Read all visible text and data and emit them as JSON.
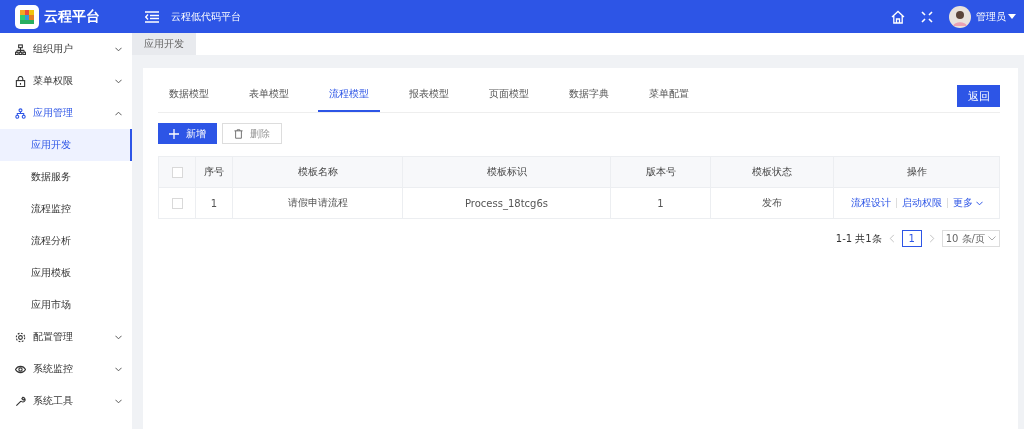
{
  "app": {
    "logo_text": "云程平台",
    "title": "云程低代码平台",
    "user": "管理员"
  },
  "sidebar": {
    "items": [
      {
        "label": "组织用户",
        "expanded": false,
        "selected": false
      },
      {
        "label": "菜单权限",
        "expanded": false,
        "selected": false
      },
      {
        "label": "应用管理",
        "expanded": true,
        "selected": true,
        "children": [
          {
            "label": "应用开发",
            "selected": true
          },
          {
            "label": "数据服务",
            "selected": false
          },
          {
            "label": "流程监控",
            "selected": false
          },
          {
            "label": "流程分析",
            "selected": false
          },
          {
            "label": "应用模板",
            "selected": false
          },
          {
            "label": "应用市场",
            "selected": false
          }
        ]
      },
      {
        "label": "配置管理",
        "expanded": false,
        "selected": false
      },
      {
        "label": "系统监控",
        "expanded": false,
        "selected": false
      },
      {
        "label": "系统工具",
        "expanded": false,
        "selected": false
      }
    ]
  },
  "page_tabs": [
    {
      "label": "应用开发",
      "selected": true
    }
  ],
  "tabs": [
    {
      "label": "数据模型",
      "selected": false
    },
    {
      "label": "表单模型",
      "selected": false
    },
    {
      "label": "流程模型",
      "selected": true
    },
    {
      "label": "报表模型",
      "selected": false
    },
    {
      "label": "页面模型",
      "selected": false
    },
    {
      "label": "数据字典",
      "selected": false
    },
    {
      "label": "菜单配置",
      "selected": false
    }
  ],
  "back_button": "返回",
  "toolbar": {
    "add": "新增",
    "delete": "删除"
  },
  "table": {
    "select_all_checked": false,
    "columns": [
      "序号",
      "模板名称",
      "模板标识",
      "版本号",
      "模板状态",
      "操作"
    ],
    "rows": [
      {
        "checked": false,
        "cells": [
          "1",
          "请假申请流程",
          "Process_18tcg6s",
          "1",
          "发布"
        ],
        "actions": [
          "流程设计",
          "启动权限"
        ],
        "more": "更多"
      }
    ]
  },
  "pagination": {
    "summary": "1-1 共1条",
    "pages": [
      {
        "label": "1",
        "selected": true
      }
    ],
    "page_size": "10 条/页"
  }
}
